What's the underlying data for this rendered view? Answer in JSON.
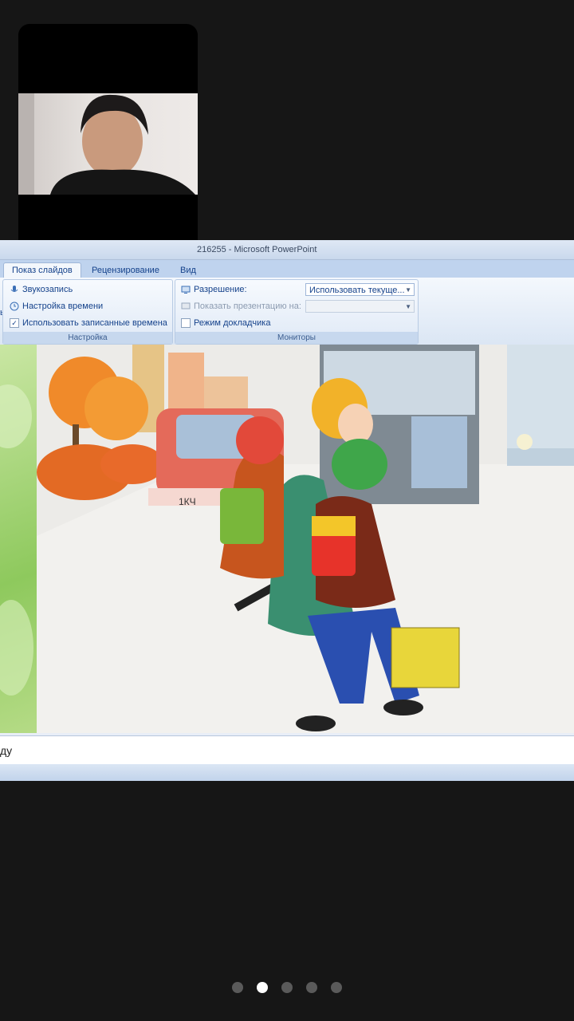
{
  "window": {
    "title": "216255 - Microsoft PowerPoint"
  },
  "tabs": [
    {
      "label": "Показ слайдов",
      "active": true
    },
    {
      "label": "Рецензирование",
      "active": false
    },
    {
      "label": "Вид",
      "active": false
    }
  ],
  "ribbon": {
    "group_settings": {
      "label": "Настройка",
      "record_narration": "Звукозапись",
      "rehearse_timings": "Настройка времени",
      "use_timings": "Использовать записанные времена",
      "use_timings_checked": true,
      "cut_label": "ь"
    },
    "group_monitors": {
      "label": "Мониторы",
      "resolution_label": "Разрешение:",
      "resolution_value": "Использовать текуще...",
      "show_on_label": "Показать презентацию на:",
      "show_on_value": "",
      "presenter_view": "Режим докладчика",
      "presenter_view_checked": false
    }
  },
  "slide": {
    "car_plate": "1КЧ",
    "image_description_icon": "children-crossing-road-illustration"
  },
  "notes": {
    "text": "ду"
  },
  "pager": {
    "count": 5,
    "active_index": 1
  },
  "colors": {
    "background": "#161616",
    "ribbon_accent": "#15428b",
    "slide_green": "#8ec95d"
  }
}
